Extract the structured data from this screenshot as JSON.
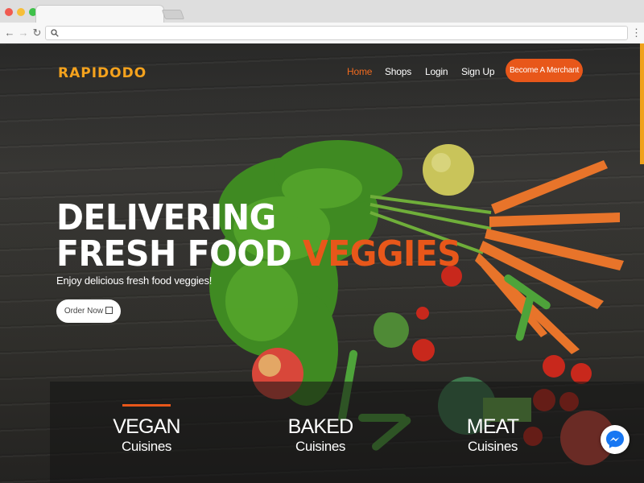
{
  "browser": {
    "icons": [
      "back-icon",
      "forward-icon",
      "reload-icon",
      "search-icon",
      "menu-dots-icon"
    ]
  },
  "header": {
    "logo": "RAPIDODO",
    "nav": [
      "Home",
      "Shops",
      "Login",
      "Sign Up"
    ],
    "active_nav": "Home",
    "merchant_button": "Become A Merchant"
  },
  "hero": {
    "line1": "DELIVERING",
    "line2": "FRESH FOOD",
    "line2_accent": "VEGGIES",
    "subtitle": "Enjoy delicious fresh food veggies!",
    "order_button": "Order Now"
  },
  "categories": [
    {
      "title": "VEGAN",
      "subtitle": "Cuisines",
      "active": true
    },
    {
      "title": "BAKED",
      "subtitle": "Cuisines",
      "active": false
    },
    {
      "title": "MEAT",
      "subtitle": "Cuisines",
      "active": false
    }
  ],
  "colors": {
    "accent": "#e8571a",
    "logo": "#f4a21d",
    "messenger": "#1877f2"
  }
}
